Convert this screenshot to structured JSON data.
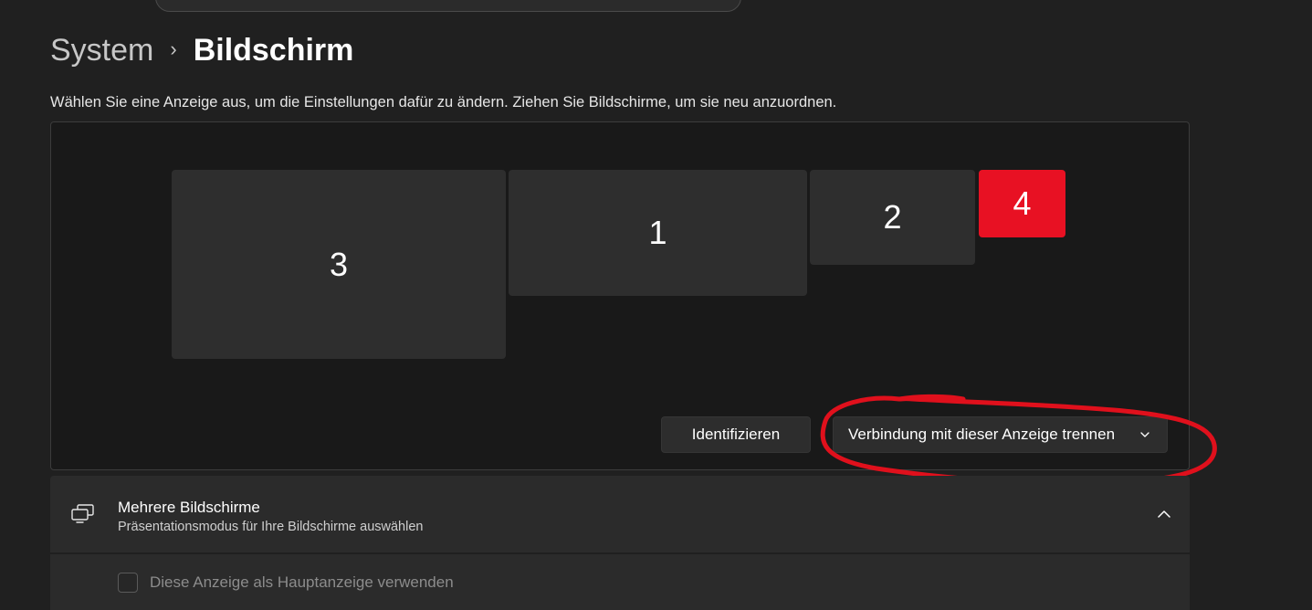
{
  "breadcrumb": {
    "parent": "System",
    "separator": "›",
    "current": "Bildschirm"
  },
  "instructions": "Wählen Sie eine Anzeige aus, um die Einstellungen dafür zu ändern. Ziehen Sie Bildschirme, um sie neu anzuordnen.",
  "monitors": [
    {
      "label": "3",
      "selected": false
    },
    {
      "label": "1",
      "selected": false
    },
    {
      "label": "2",
      "selected": false
    },
    {
      "label": "4",
      "selected": true
    }
  ],
  "buttons": {
    "identify": "Identifizieren",
    "disconnect": "Verbindung mit dieser Anzeige trennen"
  },
  "multiple_displays": {
    "title": "Mehrere Bildschirme",
    "subtitle": "Präsentationsmodus für Ihre Bildschirme auswählen",
    "primary_checkbox_label": "Diese Anzeige als Hauptanzeige verwenden",
    "primary_checked": false
  },
  "colors": {
    "background": "#202020",
    "selected_monitor": "#e81123",
    "annotation": "#e0101c"
  },
  "icons": {
    "breadcrumb_separator": "chevron-right-icon",
    "dropdown": "chevron-down-icon",
    "section": "multiple-displays-icon",
    "collapse": "chevron-up-icon"
  }
}
